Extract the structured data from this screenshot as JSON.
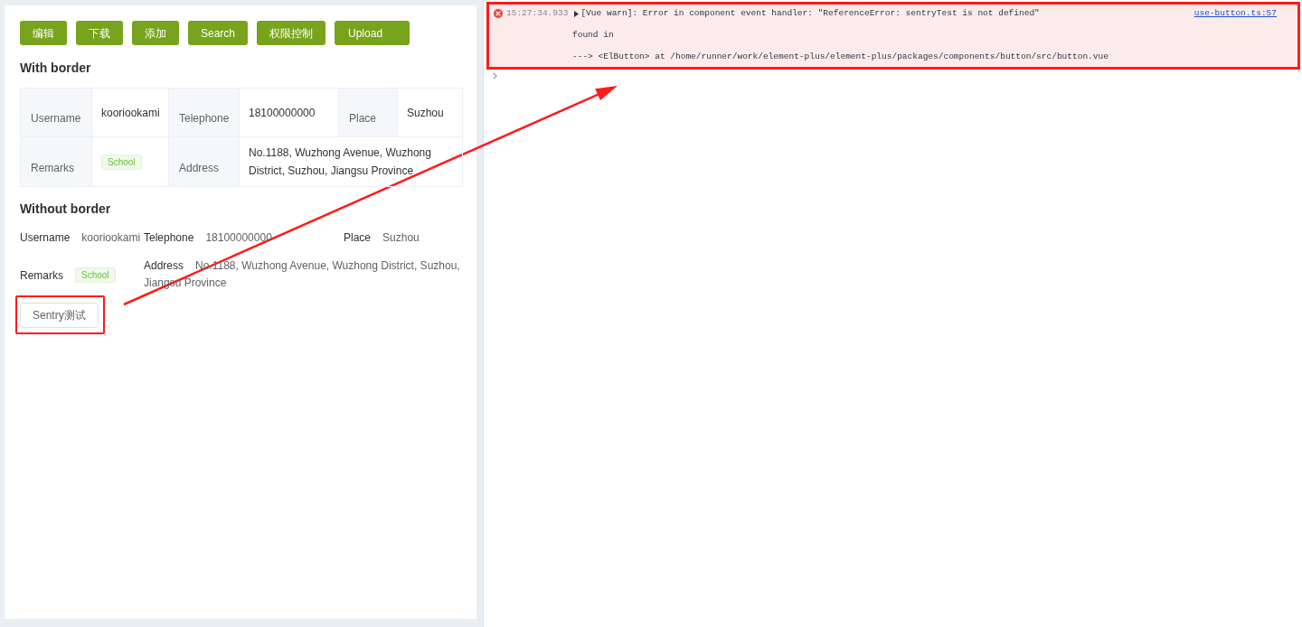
{
  "toolbar": {
    "buttons": [
      "编辑",
      "下载",
      "添加",
      "Search",
      "权限控制",
      "Upload"
    ]
  },
  "bordered_descriptions": {
    "title": "With border",
    "items": [
      {
        "label": "Username",
        "kind": "text",
        "value": "kooriookami"
      },
      {
        "label": "Telephone",
        "kind": "text",
        "value": "18100000000"
      },
      {
        "label": "Place",
        "kind": "text",
        "value": "Suzhou"
      },
      {
        "label": "Remarks",
        "kind": "tag",
        "value": "School"
      },
      {
        "label": "Address",
        "kind": "text",
        "value": "No.1188, Wuzhong Avenue, Wuzhong District, Suzhou, Jiangsu Province"
      }
    ]
  },
  "plain_descriptions": {
    "title": "Without border",
    "items": [
      {
        "label": "Username",
        "kind": "text",
        "value": "kooriookami"
      },
      {
        "label": "Telephone",
        "kind": "text",
        "value": "18100000000"
      },
      {
        "label": "Place",
        "kind": "text",
        "value": "Suzhou"
      },
      {
        "label": "Remarks",
        "kind": "tag",
        "value": "School"
      },
      {
        "label": "Address",
        "kind": "text",
        "value": "No.1188, Wuzhong Avenue, Wuzhong District, Suzhou, Jiangsu Province"
      }
    ]
  },
  "sentry_button": "Sentry测试",
  "console": {
    "messages": [
      {
        "kind": "error",
        "timestamp": "15:27:34.933",
        "expanded": false,
        "text": "[Vue warn]: Error in component event handler: \"ReferenceError: sentryTest is not defined\"",
        "source": "use-button.ts:57",
        "details": [
          "found in",
          "---> <ElButton> at /home/runner/work/element-plus/element-plus/packages/components/button/src/button.vue"
        ]
      }
    ]
  }
}
